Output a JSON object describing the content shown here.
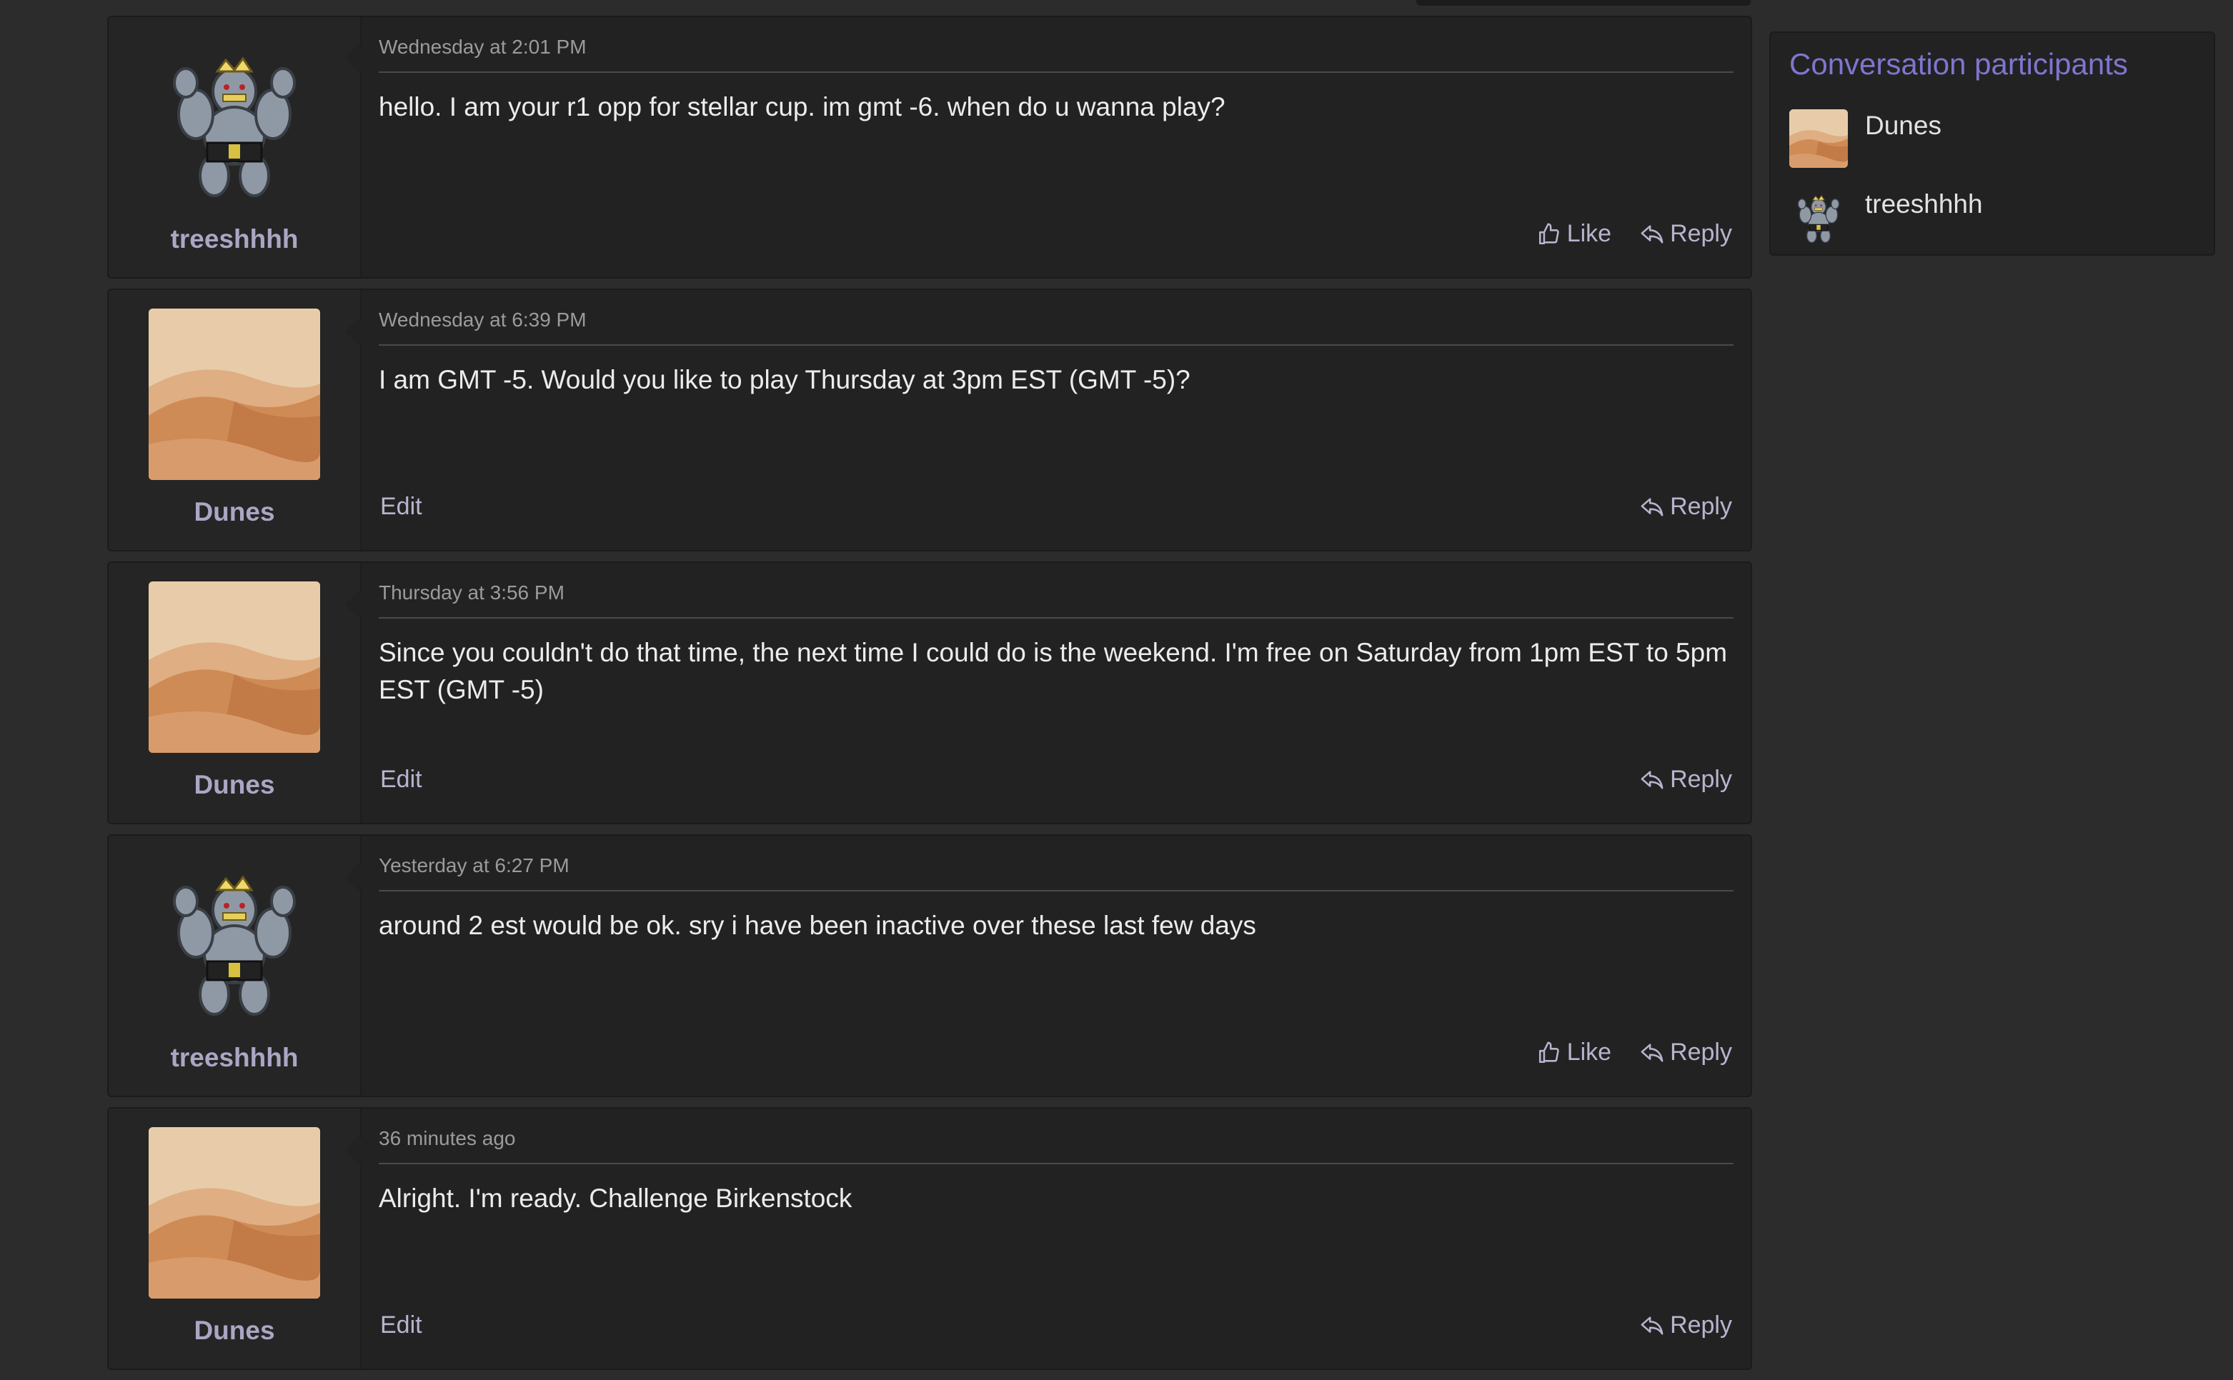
{
  "colors": {
    "background": "#2c2c2c",
    "panel": "#222222",
    "accent": "#7e76cf",
    "username": "#aaa6c4"
  },
  "messages": [
    {
      "author": "treeshhhh",
      "avatar": "machoke-sprite",
      "date": "Wednesday at 2:01 PM",
      "text": "hello. I am your r1 opp for stellar cup. im gmt -6. when do u wanna play?",
      "like_label": "Like",
      "reply_label": "Reply"
    },
    {
      "author": "Dunes",
      "avatar": "desert-dunes",
      "date": "Wednesday at 6:39 PM",
      "text": "I am GMT -5. Would you like to play Thursday at 3pm EST (GMT -5)?",
      "edit_label": "Edit",
      "reply_label": "Reply"
    },
    {
      "author": "Dunes",
      "avatar": "desert-dunes",
      "date": "Thursday at 3:56 PM",
      "text": "Since you couldn't do that time, the next time I could do is the weekend. I'm free on Saturday from 1pm EST to 5pm EST (GMT -5)",
      "edit_label": "Edit",
      "reply_label": "Reply"
    },
    {
      "author": "treeshhhh",
      "avatar": "machoke-sprite",
      "date": "Yesterday at 6:27 PM",
      "text": "around 2 est would be ok. sry i have been inactive over these last few days",
      "like_label": "Like",
      "reply_label": "Reply"
    },
    {
      "author": "Dunes",
      "avatar": "desert-dunes",
      "date": "36 minutes ago",
      "text": "Alright. I'm ready. Challenge Birkenstock",
      "edit_label": "Edit",
      "reply_label": "Reply"
    }
  ],
  "sidebar": {
    "title": "Conversation participants",
    "participants": [
      {
        "name": "Dunes",
        "avatar": "desert-dunes"
      },
      {
        "name": "treeshhhh",
        "avatar": "machoke-sprite"
      }
    ]
  },
  "icons": {
    "like": "thumbs-up-icon",
    "reply": "reply-arrow-icon"
  }
}
